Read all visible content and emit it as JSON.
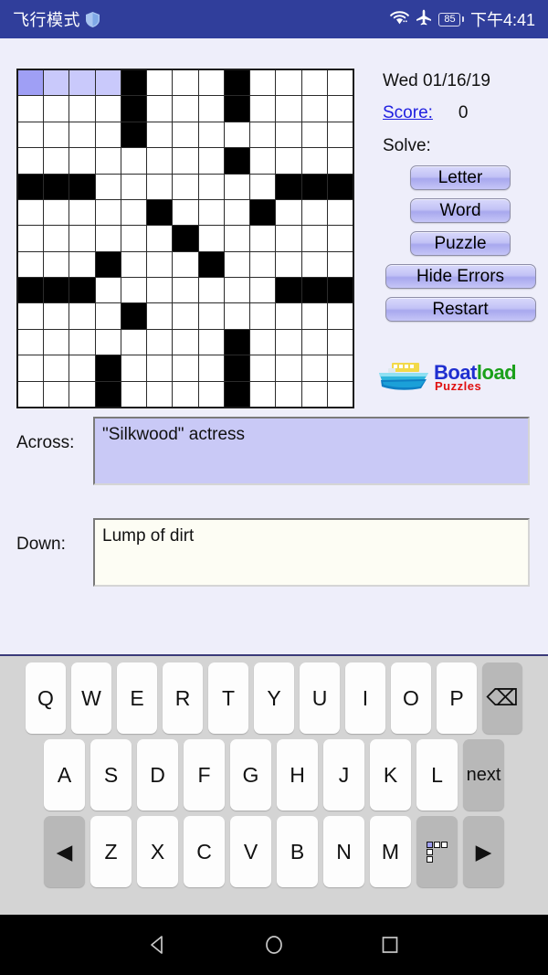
{
  "status_bar": {
    "left_text": "飞行模式",
    "shield_icon": "shield-icon",
    "wifi_icon": "wifi-icon",
    "airplane_icon": "airplane-mode-icon",
    "battery_level": "85",
    "time": "下午4:41",
    "background_color": "#303e9b"
  },
  "puzzle": {
    "date": "Wed 01/16/19",
    "score_label": "Score:",
    "score_value": "0",
    "solve_label": "Solve:",
    "buttons": {
      "letter": "Letter",
      "word": "Word",
      "puzzle": "Puzzle",
      "hide_errors": "Hide Errors",
      "restart": "Restart"
    },
    "logo": {
      "boat": "Boat",
      "load": "load",
      "sub": "Puzzles",
      "boat_color": "#1f2fd0",
      "load_color": "#1aa01a",
      "sub_color": "#e01010"
    },
    "grid": {
      "rows": 13,
      "cols": 13,
      "cursor": [
        0,
        0
      ],
      "highlight": [
        [
          0,
          1
        ],
        [
          0,
          2
        ],
        [
          0,
          3
        ]
      ],
      "black_cells": [
        [
          0,
          4
        ],
        [
          0,
          8
        ],
        [
          1,
          4
        ],
        [
          1,
          8
        ],
        [
          2,
          4
        ],
        [
          3,
          8
        ],
        [
          4,
          0
        ],
        [
          4,
          1
        ],
        [
          4,
          2
        ],
        [
          4,
          10
        ],
        [
          4,
          11
        ],
        [
          4,
          12
        ],
        [
          5,
          5
        ],
        [
          5,
          9
        ],
        [
          6,
          6
        ],
        [
          7,
          3
        ],
        [
          7,
          7
        ],
        [
          8,
          0
        ],
        [
          8,
          1
        ],
        [
          8,
          2
        ],
        [
          8,
          10
        ],
        [
          8,
          11
        ],
        [
          8,
          12
        ],
        [
          9,
          4
        ],
        [
          10,
          8
        ],
        [
          11,
          3
        ],
        [
          11,
          8
        ],
        [
          12,
          3
        ],
        [
          12,
          8
        ]
      ],
      "cursor_color": "#9f9ff5",
      "highlight_color": "#c9c9fb"
    }
  },
  "clues": {
    "across_label": "Across:",
    "across_text": "\"Silkwood\" actress",
    "down_label": "Down:",
    "down_text": "Lump of dirt",
    "across_active_color": "#c9c9f6",
    "down_bg_color": "#fdfdf4"
  },
  "keyboard": {
    "row1": [
      "Q",
      "W",
      "E",
      "R",
      "T",
      "Y",
      "U",
      "I",
      "O",
      "P"
    ],
    "row1_action": "⌫",
    "row2": [
      "A",
      "S",
      "D",
      "F",
      "G",
      "H",
      "J",
      "K",
      "L"
    ],
    "row2_action": "next",
    "row3_left": "◀",
    "row3": [
      "Z",
      "X",
      "C",
      "V",
      "B",
      "N",
      "M"
    ],
    "row3_grid_icon": "crossword-grid-icon",
    "row3_right": "▶"
  },
  "navbar": {
    "back": "back-icon",
    "home": "home-icon",
    "recents": "recents-icon"
  }
}
